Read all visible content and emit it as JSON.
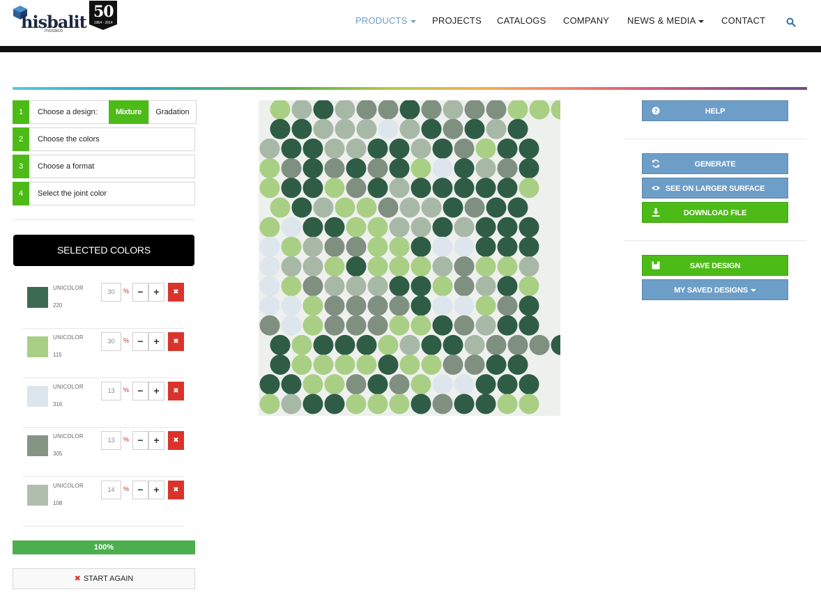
{
  "header": {
    "logo_text": "hisbalit",
    "logo_sub": "mosaico",
    "badge_number": "50",
    "badge_years": "1964 · 2014",
    "nav": [
      {
        "label": "PRODUCTS",
        "active": true,
        "dropdown": true
      },
      {
        "label": "PROJECTS",
        "active": false,
        "dropdown": false
      },
      {
        "label": "CATALOGS",
        "active": false,
        "dropdown": false
      },
      {
        "label": "COMPANY",
        "active": false,
        "dropdown": false
      },
      {
        "label": "NEWS & MEDIA",
        "active": false,
        "dropdown": true
      },
      {
        "label": "CONTACT",
        "active": false,
        "dropdown": false
      }
    ],
    "accent_color": "#6b9ac4"
  },
  "steps": {
    "s1": {
      "num": "1",
      "label": "Choose a design:"
    },
    "s2": {
      "num": "2",
      "label": "Choose the colors"
    },
    "s3": {
      "num": "3",
      "label": "Choose a format"
    },
    "s4": {
      "num": "4",
      "label": "Select the joint color"
    },
    "design_options": {
      "mixture": "Mixture",
      "gradation": "Gradation",
      "selected": "Mixture"
    }
  },
  "selected_colors": {
    "title": "SELECTED COLORS",
    "items": [
      {
        "name": "UNICOLOR",
        "code": "220",
        "percent": "30",
        "color": "#3d6b52"
      },
      {
        "name": "UNICOLOR",
        "code": "115",
        "percent": "30",
        "color": "#a9cf85"
      },
      {
        "name": "UNICOLOR",
        "code": "316",
        "percent": "13",
        "color": "#dde6ec"
      },
      {
        "name": "UNICOLOR",
        "code": "305",
        "percent": "13",
        "color": "#859585"
      },
      {
        "name": "UNICOLOR",
        "code": "108",
        "percent": "14",
        "color": "#b0bfae"
      }
    ],
    "pct_sign": "%",
    "minus": "−",
    "plus": "+",
    "remove": "✖"
  },
  "progress": {
    "label": "100%",
    "value": 100
  },
  "start_again": {
    "label": "START AGAIN"
  },
  "mosaic": {
    "tile_colors": {
      "a": "#2f5c45",
      "b": "#a9cf85",
      "c": "#dde6ec",
      "d": "#7f8f80",
      "e": "#a8b8a6"
    },
    "rows": [
      "beaeddadeddbbb",
      "aaeeeceadaea",
      "eaaeeaaeadbaa",
      "bdadadabcaeda",
      "baabdaeaaaaab",
      "baebbdeeadaa",
      "bcaabbeeaeaaa",
      "cbeddbbaccaaa",
      "ceebabbbedbbe",
      "cbdeeeaabdeab",
      "ccbddddaccbda",
      "dcbdddbbadeaa",
      "abaaabeaaeddda",
      "abbbbabbddaa",
      "aabbdadbccaaa",
      "beaabbbadaabb"
    ]
  },
  "right_panel": {
    "help": "HELP",
    "generate": "GENERATE",
    "larger_surface": "SEE ON LARGER SURFACE",
    "download": "DOWNLOAD FILE",
    "save": "SAVE DESIGN",
    "my_saved": "MY SAVED DESIGNS"
  }
}
